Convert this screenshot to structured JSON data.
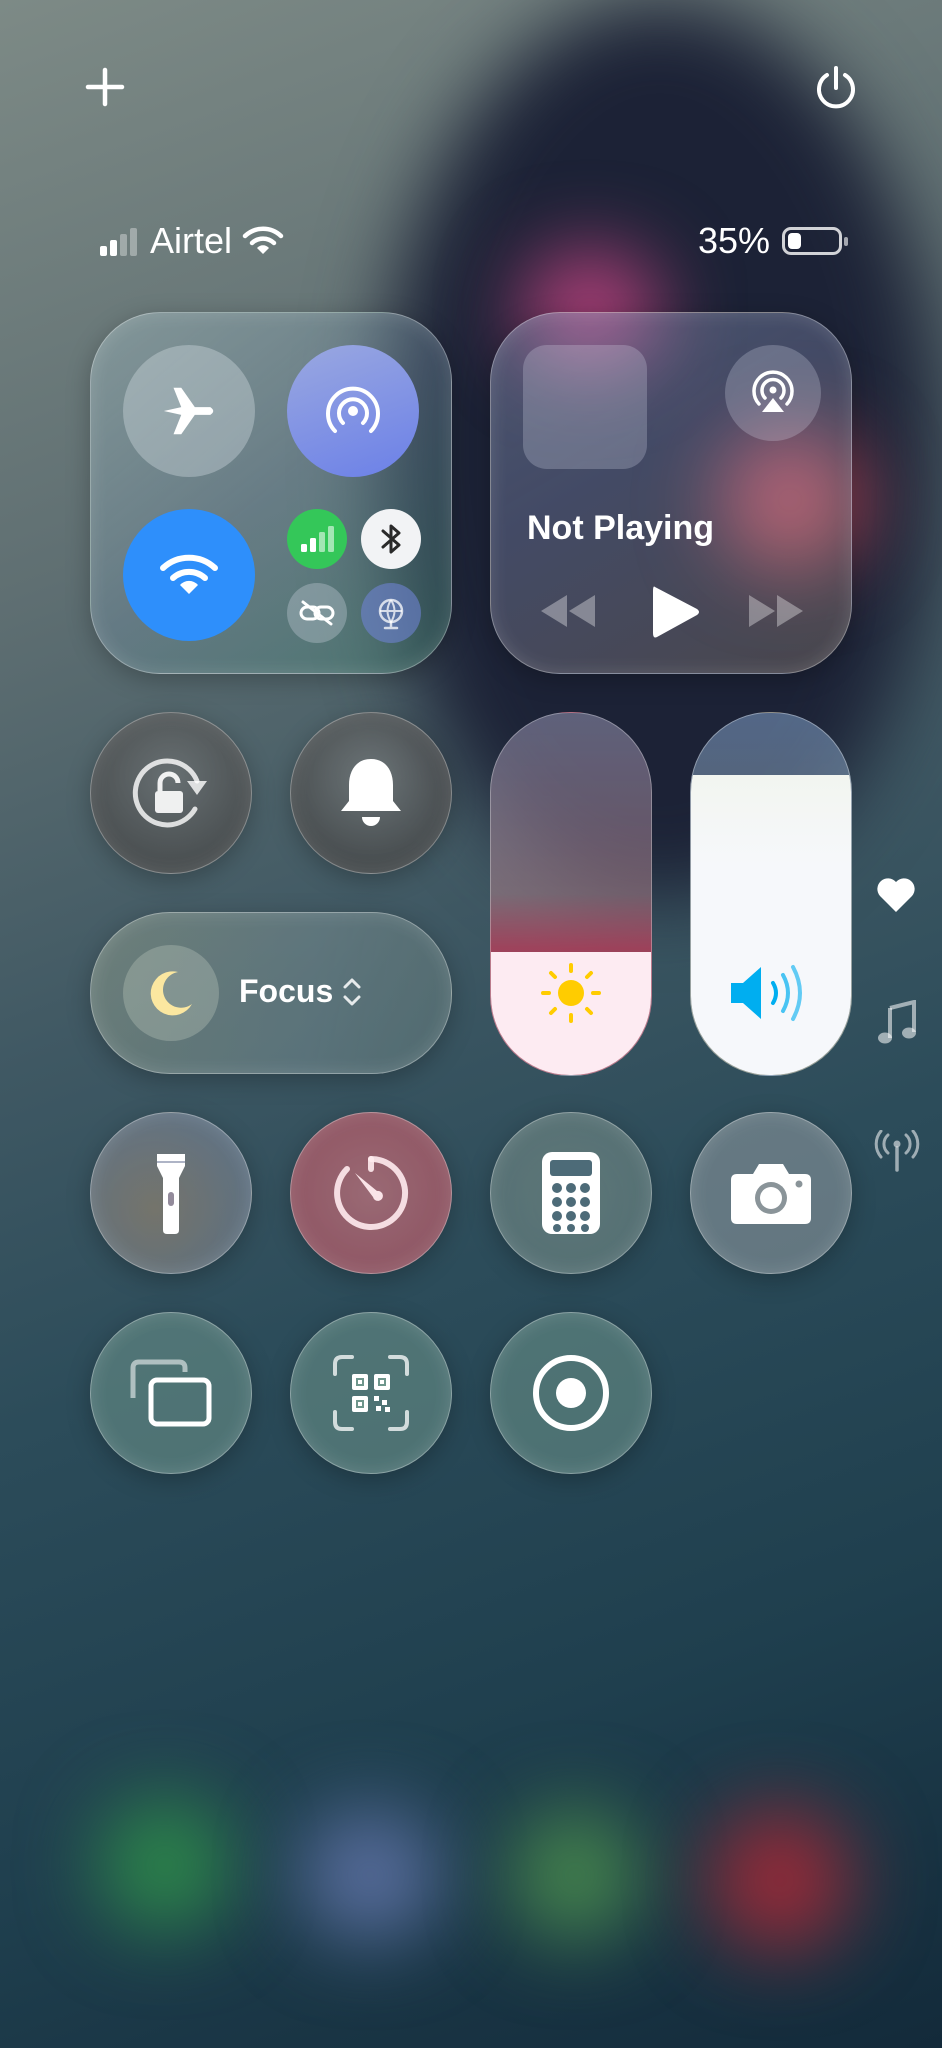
{
  "top_controls": {
    "add_icon": "plus-icon",
    "power_icon": "power-icon"
  },
  "status_bar": {
    "carrier": "Airtel",
    "battery_percent": "35%",
    "signal_bars_active": 2,
    "signal_bars_total": 4,
    "battery_level": 0.35
  },
  "connectivity": {
    "airplane": "airplane-icon",
    "airdrop": "airdrop-icon",
    "wifi": "wifi-icon",
    "cellular": "cellular-icon",
    "bluetooth": "bluetooth-icon",
    "personal_hotspot": "hotspot-link-icon",
    "vpn": "globe-icon",
    "wifi_color": "#2e8ffb",
    "cellular_color": "#34c759"
  },
  "now_playing": {
    "title": "Not Playing",
    "airplay_icon": "airplay-icon",
    "prev_icon": "rewind-icon",
    "play_icon": "play-icon",
    "next_icon": "fast-forward-icon"
  },
  "focus": {
    "label": "Focus",
    "icon": "moon-icon",
    "moon_color": "#fbe7a0"
  },
  "sliders": {
    "brightness_level": 0.34,
    "volume_level": 0.83,
    "brightness_icon_color": "#ffcc00",
    "volume_icon_color": "#00aef0"
  },
  "side_pages": {
    "favorites": "heart-icon",
    "music": "music-note-icon",
    "connectivity": "antenna-icon"
  },
  "buttons": {
    "rotation_lock": "rotation-lock-icon",
    "silent_mode": "bell-icon",
    "flashlight": "flashlight-icon",
    "timer": "timer-icon",
    "calculator": "calculator-icon",
    "camera": "camera-icon",
    "screen_mirroring": "screen-mirroring-icon",
    "code_scanner": "qr-code-icon",
    "screen_recording": "record-icon"
  }
}
